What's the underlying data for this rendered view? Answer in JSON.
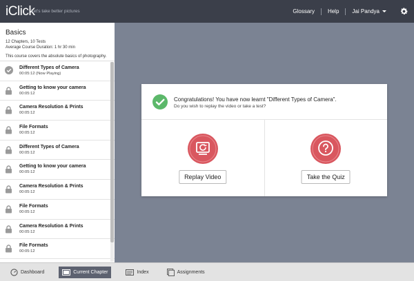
{
  "app": {
    "name": "iClick",
    "tagline": "Let's take better pictures"
  },
  "header": {
    "glossary": "Glossary",
    "help": "Help",
    "user": "Jai Pandya"
  },
  "course": {
    "title": "Basics",
    "meta1": "12 Chapters, 10 Tests",
    "meta2": "Average Course Duration: 1 hr 30 min",
    "description": "This course covers the absolute basics of photography."
  },
  "chapters": [
    {
      "title": "Different Types of Camera",
      "sub": "00:05:12 (Now Playing)",
      "state": "done"
    },
    {
      "title": "Getting to know your camera",
      "sub": "00:05:12",
      "state": "locked"
    },
    {
      "title": "Camera Resolution & Prints",
      "sub": "00:05:12",
      "state": "locked"
    },
    {
      "title": "File Formats",
      "sub": "00:05:12",
      "state": "locked"
    },
    {
      "title": "Different Types of Camera",
      "sub": "00:05:12",
      "state": "locked"
    },
    {
      "title": "Getting to know your camera",
      "sub": "00:05:12",
      "state": "locked"
    },
    {
      "title": "Camera Resolution & Prints",
      "sub": "00:05:12",
      "state": "locked"
    },
    {
      "title": "File Formats",
      "sub": "00:05:12",
      "state": "locked"
    },
    {
      "title": "Camera Resolution & Prints",
      "sub": "00:05:12",
      "state": "locked"
    },
    {
      "title": "File Formats",
      "sub": "00:05:12",
      "state": "locked"
    }
  ],
  "dialog": {
    "title": "Congratulations! You have now learnt \"Different Types of Camera\".",
    "subtitle": "Do you wish to replay the video or take a test?",
    "replay_label": "Replay Video",
    "quiz_label": "Take the Quiz"
  },
  "bottom": {
    "dashboard": "Dashboard",
    "current_chapter": "Current Chapter",
    "index": "Index",
    "assignments": "Assignments"
  },
  "icons": {
    "check": "check-circle-icon",
    "lock": "lock-icon",
    "replay": "replay-icon",
    "quiz": "question-icon",
    "gear": "gear-icon"
  },
  "colors": {
    "topbar": "#3b3f4a",
    "canvas": "#7b8393",
    "accent_red": "#d9575f",
    "success": "#5cb86a",
    "active_nav": "#5d6270"
  }
}
